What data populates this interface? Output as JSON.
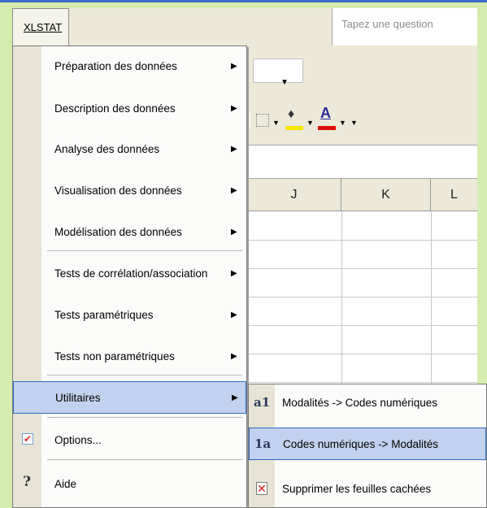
{
  "menubar": {
    "xlstat_menu": "XLSTAT",
    "question_placeholder": "Tapez une question"
  },
  "sheet": {
    "columns": [
      "J",
      "K",
      "L"
    ]
  },
  "xlstat_dropdown": {
    "items": [
      {
        "label": "Préparation des données",
        "has_submenu": true
      },
      {
        "label": "Description des données",
        "has_submenu": true
      },
      {
        "label": "Analyse des données",
        "has_submenu": true
      },
      {
        "label": "Visualisation des données",
        "has_submenu": true
      },
      {
        "label": "Modélisation des données",
        "has_submenu": true
      },
      {
        "label": "Tests de corrélation/association",
        "has_submenu": true
      },
      {
        "label": "Tests paramétriques",
        "has_submenu": true
      },
      {
        "label": "Tests non paramétriques",
        "has_submenu": true
      },
      {
        "label": "Utilitaires",
        "has_submenu": true,
        "active": true
      },
      {
        "label": "Options...",
        "icon": "checkmark-icon"
      },
      {
        "label": "Aide",
        "icon": "help-icon"
      }
    ]
  },
  "utilitaires_submenu": {
    "items": [
      {
        "label": "Modalités -> Codes numériques",
        "icon_text": "a1"
      },
      {
        "label": "Codes numériques -> Modalités",
        "icon_text": "1a",
        "active": true
      },
      {
        "label": "Supprimer les feuilles cachées",
        "icon": "delete-sheet-icon"
      }
    ]
  },
  "colors": {
    "background": "#d4ecb0",
    "menu_highlight": "#c1d2ee",
    "highlight_border": "#316ac5",
    "accent_blue": "#3a6bc8"
  }
}
